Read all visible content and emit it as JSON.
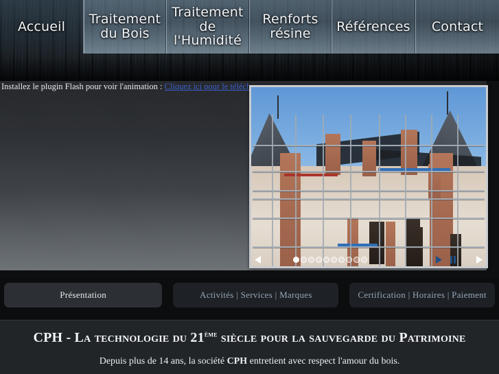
{
  "nav": {
    "items": [
      {
        "id": "accueil",
        "line1": "Accueil",
        "line2": "",
        "active": true
      },
      {
        "id": "traitement-bois",
        "line1": "Traitement",
        "line2": "du Bois",
        "active": false
      },
      {
        "id": "traitement-humidite",
        "line1": "Traitement",
        "line2": "de l'Humidité",
        "active": false
      },
      {
        "id": "renforts-resine",
        "line1": "Renforts",
        "line2": "résine",
        "active": false
      },
      {
        "id": "references",
        "line1": "Références",
        "line2": "",
        "active": false
      },
      {
        "id": "contact",
        "line1": "Contact",
        "line2": "",
        "active": false
      }
    ]
  },
  "flash": {
    "message": "Installez le plugin Flash pour voir l'animation : ",
    "link_text": "Cliquez ici pour le télécharger"
  },
  "slideshow": {
    "alt": "Château en rénovation avec échafaudages",
    "dot_count": 10,
    "active_dot_index": 0,
    "controls": {
      "prev": "prev-arrow",
      "next": "next-arrow",
      "play": "play-icon",
      "pause": "pause-icon"
    }
  },
  "tabs": [
    {
      "id": "presentation",
      "label": "Présentation",
      "active": true
    },
    {
      "id": "activites-services-marques",
      "label": "Activités | Services | Marques",
      "active": false
    },
    {
      "id": "certification-horaires-paiement",
      "label": "Certification | Horaires | Paiement",
      "active": false
    }
  ],
  "headline": {
    "part1": "CPH - ",
    "part2": "La technologie du ",
    "number": "21",
    "sup": "ème",
    "part3": " siècle pour la sauvegarde du Patrimoine"
  },
  "intro": {
    "before": "Depuis plus de 14 ans, la société ",
    "brand": "CPH",
    "after": " entretient avec respect l'amour du bois."
  },
  "colors": {
    "nav_tab": "#7e9aae",
    "link": "#3b5fcc",
    "panel_dark": "#24262a",
    "panel_light": "#6c7176",
    "tab_active_bg": "#2c2f33",
    "tab_idle_bg": "#1e2125",
    "tab_idle_text": "#97a6b8",
    "footer_bg": "#222528"
  }
}
